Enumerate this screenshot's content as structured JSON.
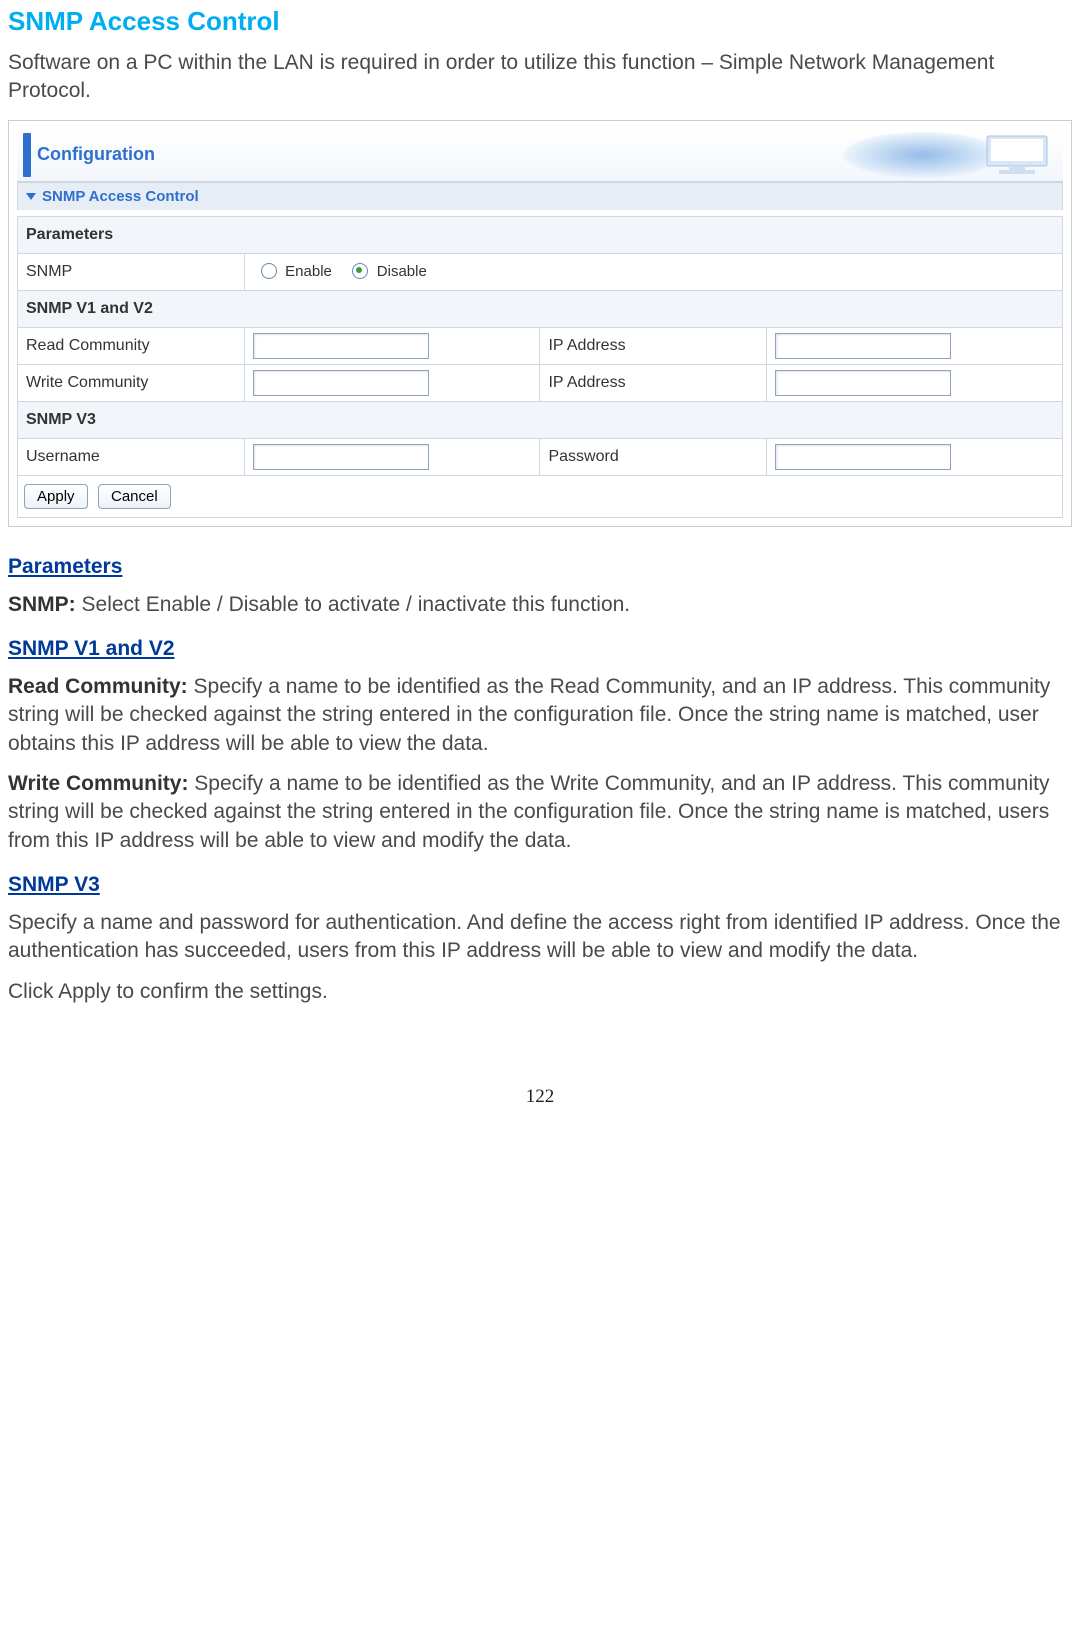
{
  "title": "SNMP Access Control",
  "intro": "Software on a PC within the LAN is required in order to utilize this function – Simple Network Management Protocol.",
  "figure": {
    "banner_label": "Configuration",
    "section_title": "SNMP Access Control",
    "rows": {
      "parameters_header": "Parameters",
      "snmp_label": "SNMP",
      "enable": "Enable",
      "disable": "Disable",
      "snmp_v1v2_header": "SNMP V1 and V2",
      "read_community": "Read Community",
      "write_community": "Write Community",
      "ip_address": "IP Address",
      "snmp_v3_header": "SNMP V3",
      "username": "Username",
      "password": "Password"
    },
    "buttons": {
      "apply": "Apply",
      "cancel": "Cancel"
    }
  },
  "doc": {
    "parameters_heading": "Parameters",
    "snmp_def_label": "SNMP:",
    "snmp_def_text": " Select Enable / Disable to activate / inactivate this function.",
    "v1v2_heading": "SNMP V1 and V2",
    "read_label": "Read Community:",
    "read_text": " Specify a name to be identified as the Read Community, and an IP address. This community string will be checked against the string entered in the configuration file. Once the string name is matched, user obtains this IP address will be able to view the data.",
    "write_label": "Write Community:",
    "write_text": " Specify a name to be identified as the Write Community, and an IP address. This community string will be checked against the string entered in the configuration file. Once the string name is matched, users from this IP address will be able to view and modify the data.",
    "v3_heading": "SNMP V3",
    "v3_text": "Specify a name and password for authentication. And define the access right from identified IP address. Once the authentication has succeeded, users from this IP address will be able to view and modify the data.",
    "apply_text": "Click Apply to confirm the settings."
  },
  "page_number": "122"
}
